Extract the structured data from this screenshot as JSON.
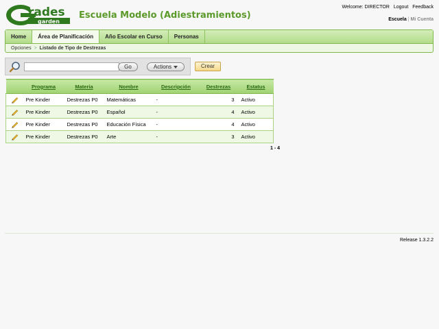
{
  "header": {
    "logo_text_main": "Grades",
    "logo_text_sub": "garden",
    "school_title": "Escuela Modelo (Adiestramientos)",
    "welcome": "Welcome: DIRECTOR",
    "logout": "Logout",
    "feedback": "Feedback",
    "account_escuela": "Escuela",
    "account_sep": "|",
    "account_mi_cuenta": "Mi Cuenta"
  },
  "nav": {
    "tabs": [
      {
        "label": "Home"
      },
      {
        "label": "Área de Planificación"
      },
      {
        "label": "Año Escolar en Curso"
      },
      {
        "label": "Personas"
      }
    ],
    "breadcrumb": {
      "root": "Opciones",
      "sep": ">",
      "current": "Listado de Tipo de Destrezas"
    }
  },
  "toolbar": {
    "search_value": "",
    "go_label": "Go",
    "actions_label": "Actions",
    "create_label": "Crear"
  },
  "table": {
    "columns": [
      "Programa",
      "Materia",
      "Nombre",
      "Descripción",
      "Destrezas",
      "Estatus"
    ],
    "rows": [
      {
        "programa": "Pre Kinder",
        "materia": "Destrezas P0",
        "nombre": "Matemáticas",
        "descripcion": "-",
        "destrezas": "3",
        "estatus": "Activo"
      },
      {
        "programa": "Pre Kinder",
        "materia": "Destrezas P0",
        "nombre": "Español",
        "descripcion": "-",
        "destrezas": "4",
        "estatus": "Activo"
      },
      {
        "programa": "Pre Kinder",
        "materia": "Destrezas P0",
        "nombre": "Educación Física",
        "descripcion": "-",
        "destrezas": "4",
        "estatus": "Activo"
      },
      {
        "programa": "Pre Kinder",
        "materia": "Destrezas P0",
        "nombre": "Arte",
        "descripcion": "-",
        "destrezas": "3",
        "estatus": "Activo"
      }
    ],
    "pagination": "1 - 4"
  },
  "footer": {
    "release": "Release 1.3.2.2"
  },
  "colors": {
    "brand_green": "#5b9a2a",
    "header_green": "#9fd272"
  },
  "icons": [
    "search-icon",
    "chevron-down-icon",
    "pencil-edit-icon"
  ]
}
